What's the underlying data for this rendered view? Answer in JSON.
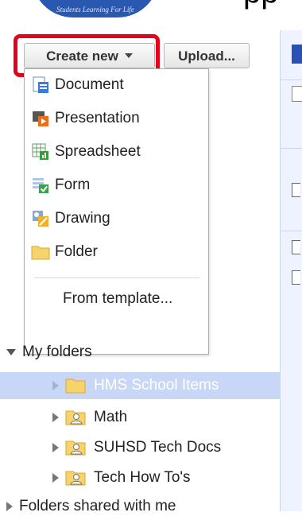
{
  "header": {
    "fragment": "pp",
    "logo_text": "Students Learning For Life"
  },
  "toolbar": {
    "create_new_label": "Create new",
    "upload_label": "Upload..."
  },
  "create_menu": {
    "items": [
      {
        "label": "Document",
        "icon": "document-icon"
      },
      {
        "label": "Presentation",
        "icon": "presentation-icon"
      },
      {
        "label": "Spreadsheet",
        "icon": "spreadsheet-icon"
      },
      {
        "label": "Form",
        "icon": "form-icon"
      },
      {
        "label": "Drawing",
        "icon": "drawing-icon"
      },
      {
        "label": "Folder",
        "icon": "folder-icon"
      }
    ],
    "from_template": "From template..."
  },
  "tree": {
    "my_folders": "My folders",
    "folders": [
      {
        "label": "HMS School Items",
        "selected": true,
        "shared": false
      },
      {
        "label": "Math",
        "selected": false,
        "shared": true
      },
      {
        "label": "SUHSD Tech Docs",
        "selected": false,
        "shared": true
      },
      {
        "label": "Tech How To's",
        "selected": false,
        "shared": true
      }
    ],
    "shared_with_me": "Folders shared with me"
  },
  "colors": {
    "highlight_ring": "#e6001e",
    "selection": "#c9d7f7",
    "folder": "#f6d36b"
  }
}
